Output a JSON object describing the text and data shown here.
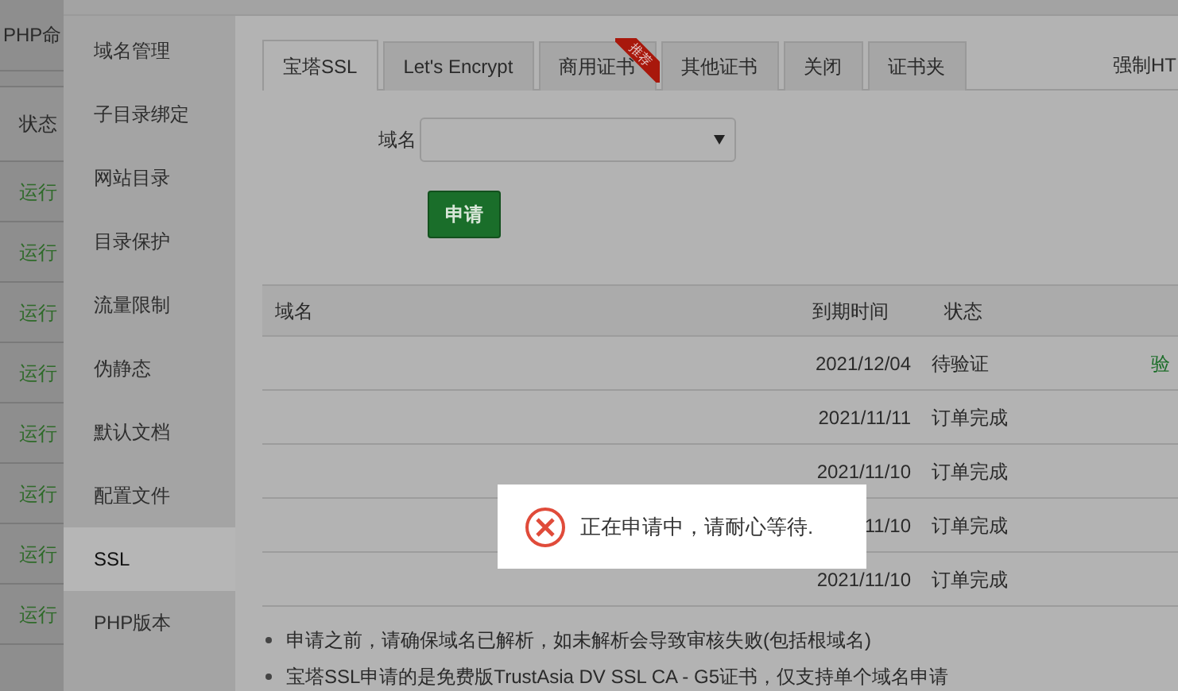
{
  "background_list": {
    "header": "PHP命",
    "status_header": "状态",
    "rows": [
      "运行",
      "运行",
      "运行",
      "运行",
      "运行",
      "运行",
      "运行",
      "运行"
    ]
  },
  "sidebar": {
    "items": [
      {
        "label": "域名管理",
        "selected": false
      },
      {
        "label": "子目录绑定",
        "selected": false
      },
      {
        "label": "网站目录",
        "selected": false
      },
      {
        "label": "目录保护",
        "selected": false
      },
      {
        "label": "流量限制",
        "selected": false
      },
      {
        "label": "伪静态",
        "selected": false
      },
      {
        "label": "默认文档",
        "selected": false
      },
      {
        "label": "配置文件",
        "selected": false
      },
      {
        "label": "SSL",
        "selected": true
      },
      {
        "label": "PHP版本",
        "selected": false
      }
    ]
  },
  "tabs": [
    {
      "label": "宝塔SSL",
      "selected": true
    },
    {
      "label": "Let's Encrypt",
      "selected": false
    },
    {
      "label": "商用证书",
      "selected": false,
      "ribbon": "推荐"
    },
    {
      "label": "其他证书",
      "selected": false
    },
    {
      "label": "关闭",
      "selected": false
    },
    {
      "label": "证书夹",
      "selected": false
    }
  ],
  "force_https": "强制HT",
  "domain_label": "域名",
  "apply_button": "申请",
  "table": {
    "columns": [
      "域名",
      "到期时间",
      "状态"
    ],
    "rows": [
      {
        "expires": "2021/12/04",
        "status": "待验证",
        "action": "验"
      },
      {
        "expires": "2021/11/11",
        "status": "订单完成"
      },
      {
        "expires": "2021/11/10",
        "status": "订单完成"
      },
      {
        "expires": "11/10",
        "status": "订单完成"
      },
      {
        "expires": "2021/11/10",
        "status": "订单完成"
      }
    ]
  },
  "notes": [
    "申请之前，请确保域名已解析，如未解析会导致审核失败(包括根域名)",
    "宝塔SSL申请的是免费版TrustAsia DV SSL CA - G5证书，仅支持单个域名申请"
  ],
  "toast": {
    "message": "正在申请中，请耐心等待."
  }
}
